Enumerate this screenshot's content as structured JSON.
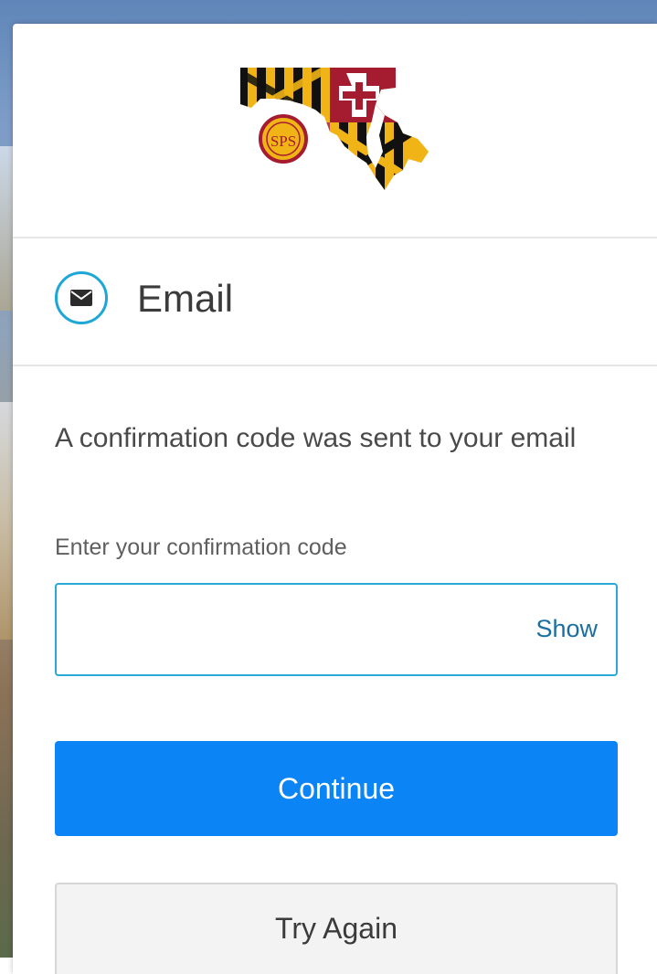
{
  "logo": {
    "seal_text": "SPS"
  },
  "header": {
    "title": "Email",
    "icon": "envelope-icon"
  },
  "main": {
    "message": "A confirmation code was sent to your email",
    "code_label": "Enter your confirmation code",
    "code_value": "",
    "show_label": "Show"
  },
  "actions": {
    "continue_label": "Continue",
    "try_again_label": "Try Again"
  },
  "colors": {
    "primary": "#0b84f5",
    "icon_ring": "#1ea7d6",
    "input_border": "#29a9d6",
    "link": "#1a6fa0",
    "flag_gold": "#f0b416",
    "flag_red": "#a51c30",
    "flag_black": "#111111"
  }
}
